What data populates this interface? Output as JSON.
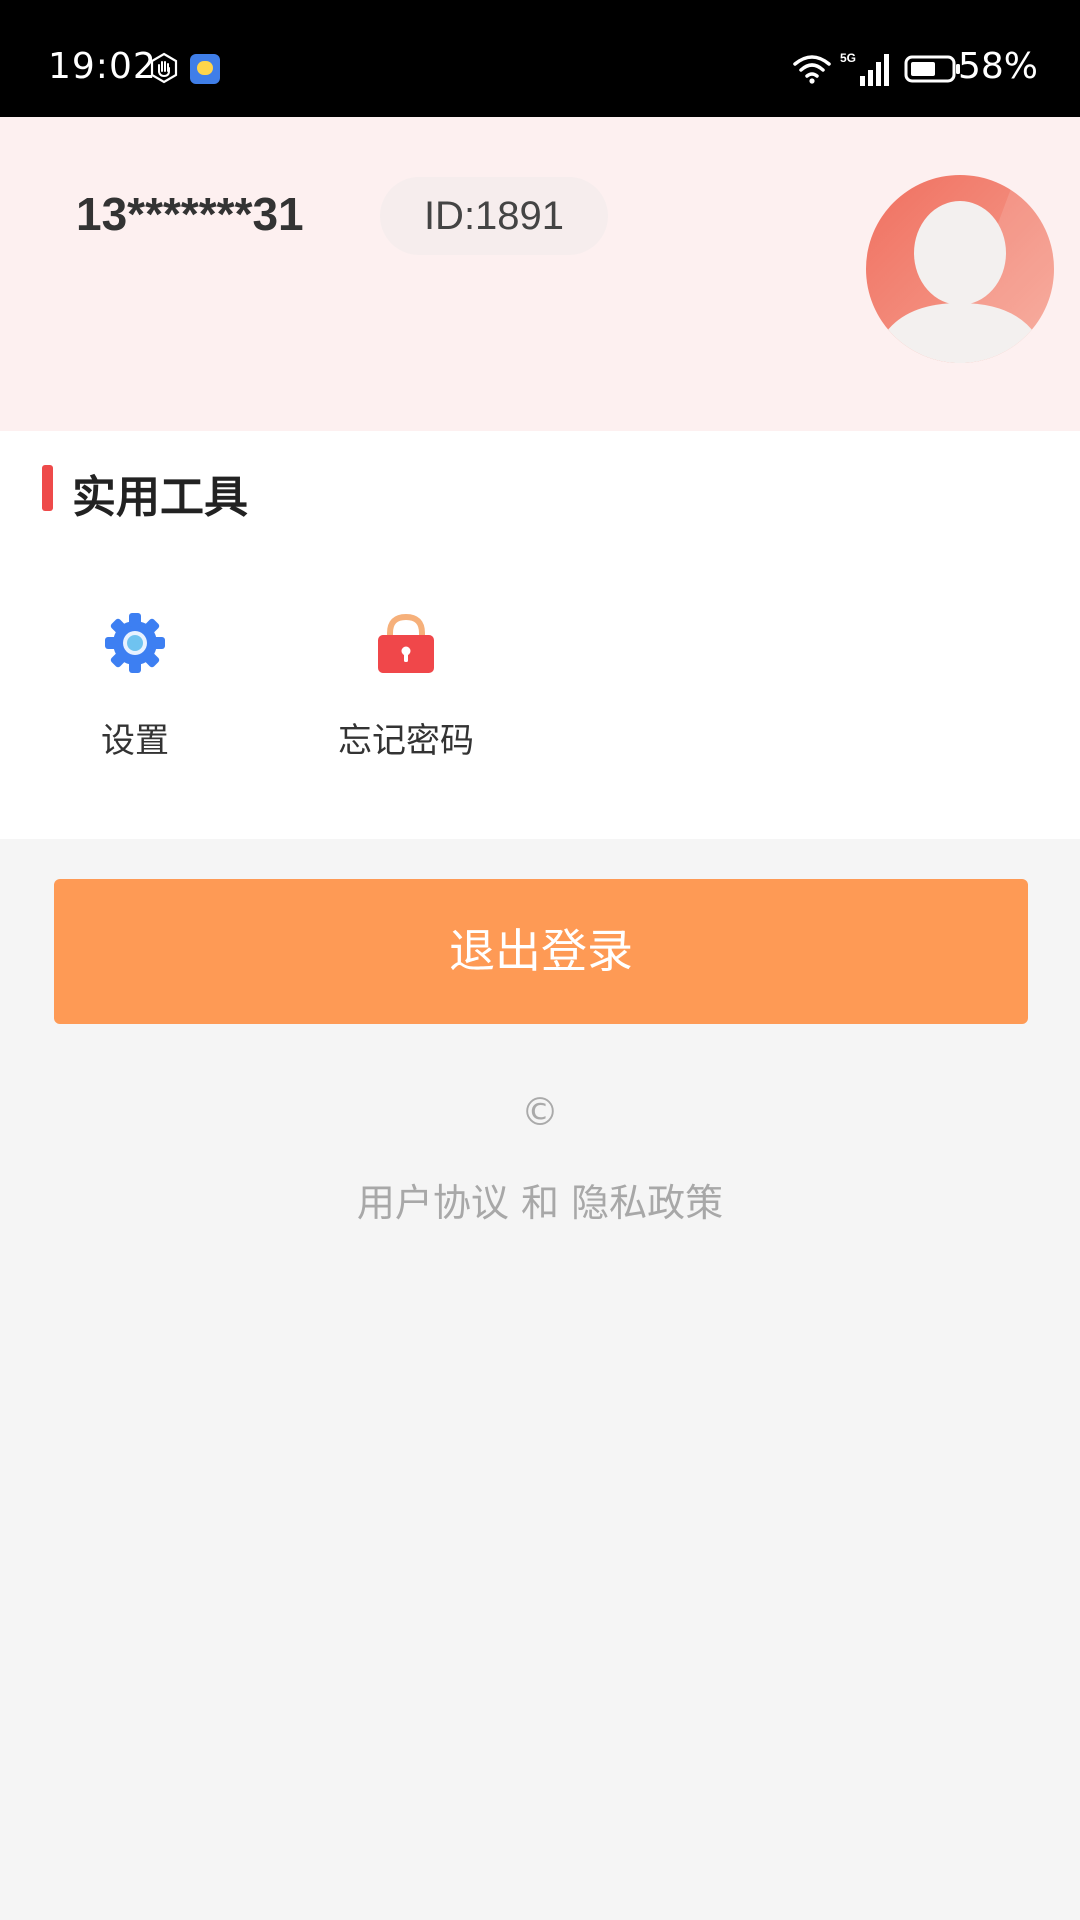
{
  "status_bar": {
    "time": "19:02",
    "network": "5G",
    "battery": "58%"
  },
  "profile": {
    "phone": "13*******31",
    "user_id": "ID:1891"
  },
  "tools": {
    "section_title": "实用工具",
    "items": [
      {
        "label": "设置",
        "icon": "gear-icon"
      },
      {
        "label": "忘记密码",
        "icon": "lock-icon"
      }
    ]
  },
  "logout_label": "退出登录",
  "footer": {
    "copyright": "©",
    "user_agreement": "用户协议",
    "and": "和",
    "privacy_policy": "隐私政策"
  },
  "colors": {
    "header_bg": "#fdf0f0",
    "accent_red": "#ee4a4a",
    "logout_orange": "#fe9a55",
    "gear_blue": "#3d7ff2"
  }
}
